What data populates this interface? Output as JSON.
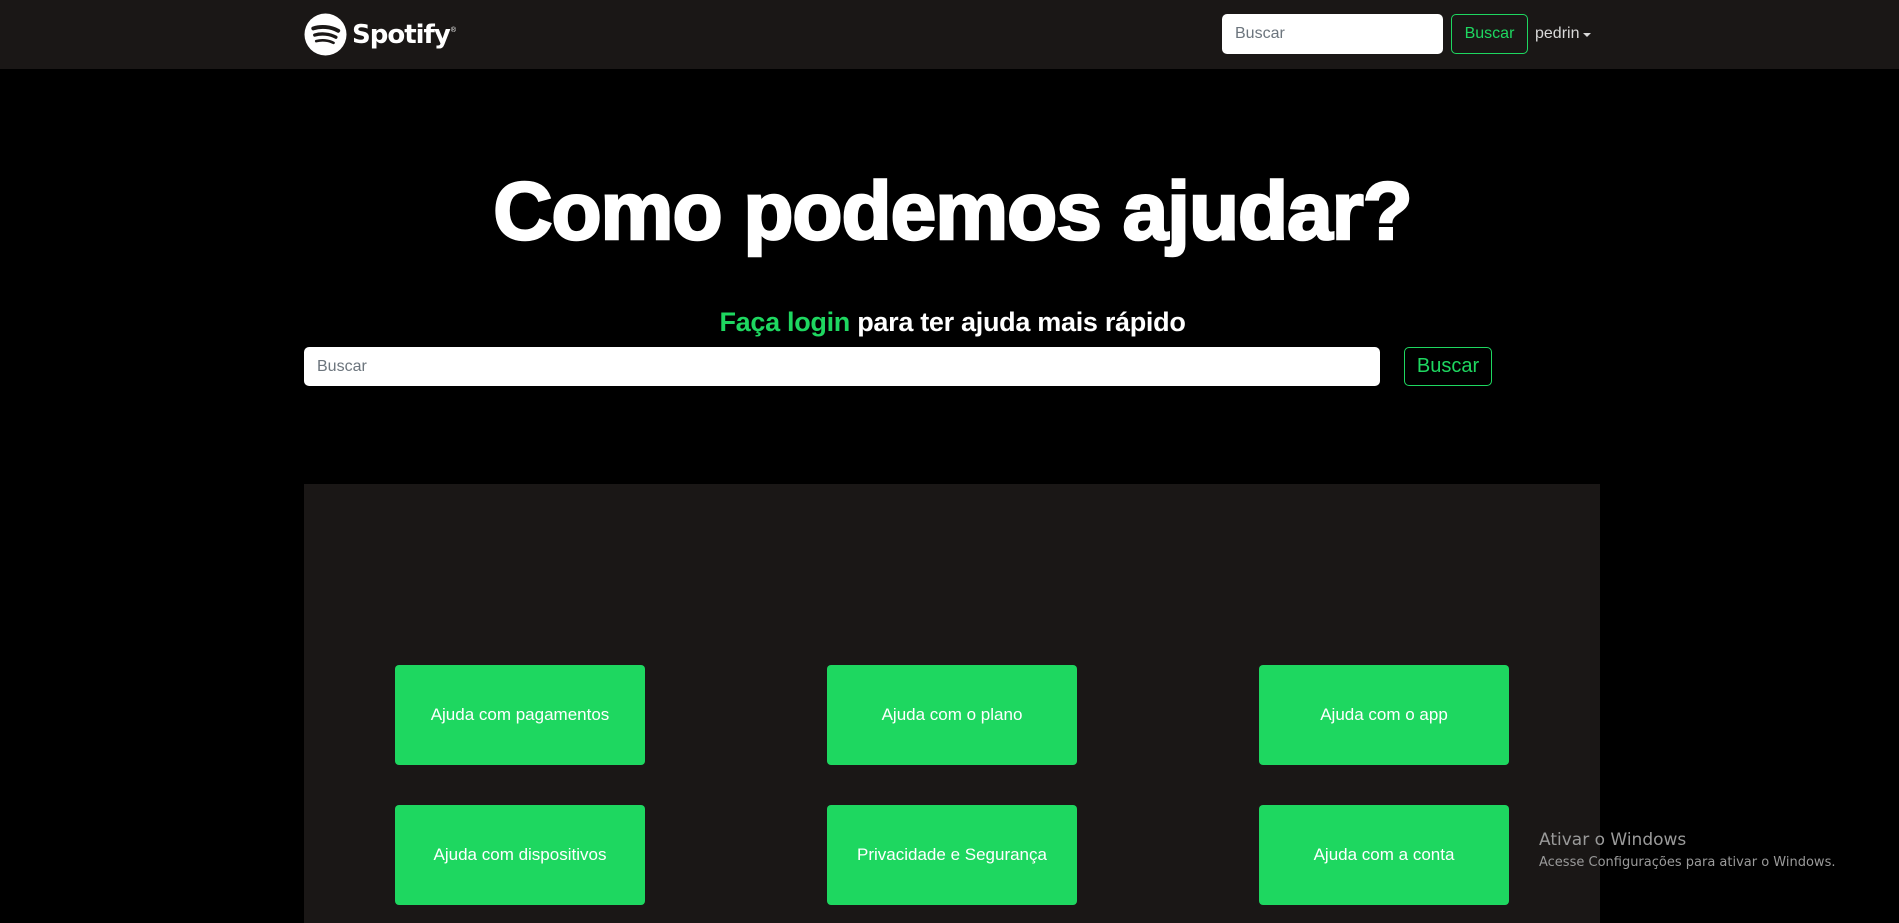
{
  "navbar": {
    "brand_name": "Spotify",
    "brand_mark": "®",
    "search_placeholder": "Buscar",
    "search_button": "Buscar",
    "user_name": "pedrin"
  },
  "hero": {
    "title": "Como podemos ajudar?",
    "login_link": "Faça login",
    "login_rest": " para ter ajuda mais rápido",
    "search_placeholder": "Buscar",
    "search_button": "Buscar"
  },
  "help_cards": [
    "Ajuda com pagamentos",
    "Ajuda com o plano",
    "Ajuda com o app",
    "Ajuda com dispositivos",
    "Privacidade e Segurança",
    "Ajuda com a conta"
  ],
  "watermark": {
    "title": "Ativar o Windows",
    "subtitle": "Acesse Configurações para ativar o Windows."
  },
  "colors": {
    "accent": "#1ed760",
    "navbar_bg": "#1a1716",
    "page_bg": "#000000",
    "panel_bg": "#1a1716"
  },
  "icons": {
    "brand_logo": "spotify-logo-icon",
    "user_caret": "caret-down-icon"
  }
}
